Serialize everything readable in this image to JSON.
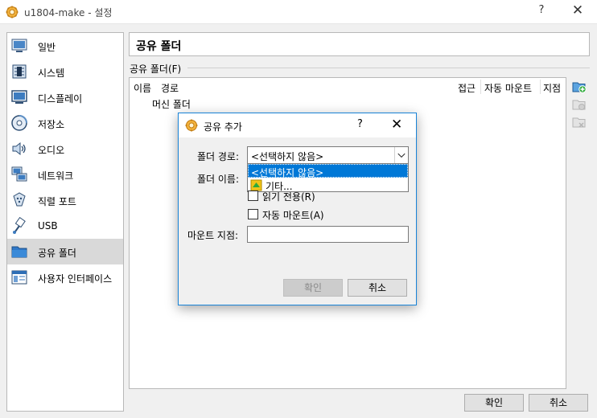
{
  "window": {
    "title": "u1804-make - 설정",
    "help_glyph": "?",
    "close_glyph": "✕"
  },
  "sidebar": {
    "items": [
      {
        "label": "일반",
        "icon": "general-icon"
      },
      {
        "label": "시스템",
        "icon": "system-chip-icon"
      },
      {
        "label": "디스플레이",
        "icon": "display-monitor-icon"
      },
      {
        "label": "저장소",
        "icon": "storage-disk-icon"
      },
      {
        "label": "오디오",
        "icon": "audio-speaker-icon"
      },
      {
        "label": "네트워크",
        "icon": "network-icon"
      },
      {
        "label": "직렬 포트",
        "icon": "serial-port-icon"
      },
      {
        "label": "USB",
        "icon": "usb-icon"
      },
      {
        "label": "공유 폴더",
        "icon": "folder-icon",
        "selected": true
      },
      {
        "label": "사용자 인터페이스",
        "icon": "user-interface-icon"
      }
    ]
  },
  "page": {
    "title": "공유 폴더",
    "section_label": "공유 폴더(F)",
    "columns": {
      "name": "이름",
      "path": "경로",
      "access": "접근",
      "auto_mount": "자동 마운트",
      "mount_point": "지점"
    },
    "tree_row": "머신 폴더"
  },
  "buttons": {
    "ok": "확인",
    "cancel": "취소"
  },
  "dialog": {
    "title": "공유 추가",
    "help_glyph": "?",
    "close_glyph": "✕",
    "folder_path_label": "폴더 경로:",
    "folder_path_value": "<선택하지 않음>",
    "folder_path_options": [
      "<선택하지 않음>",
      "기타..."
    ],
    "folder_name_label": "폴더 이름:",
    "read_only_label": "읽기 전용(R)",
    "read_only_checked": false,
    "auto_mount_label": "자동 마운트(A)",
    "auto_mount_checked": false,
    "mount_point_label": "마운트 지점:",
    "mount_point_value": "",
    "ok": "확인",
    "cancel": "취소"
  },
  "colors": {
    "accent": "#0078d7",
    "dialog_border": "#1883d7",
    "selected_sidebar": "#d9d9d9"
  }
}
